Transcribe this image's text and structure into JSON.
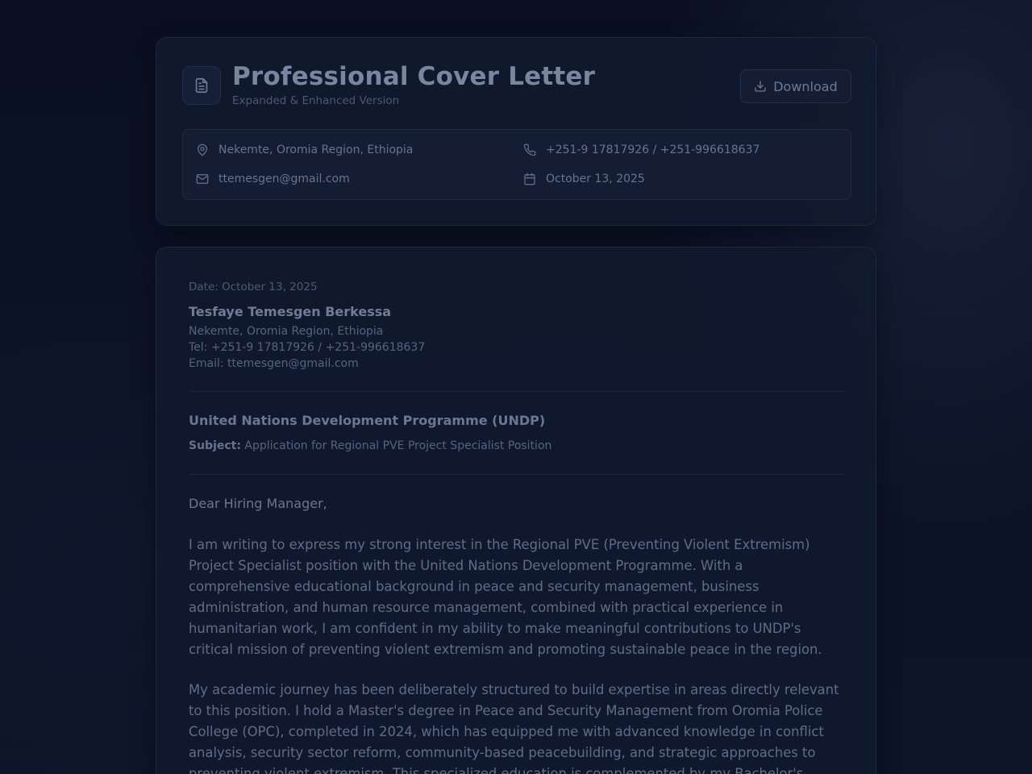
{
  "header": {
    "title": "Professional Cover Letter",
    "subtitle": "Expanded & Enhanced Version",
    "download_label": "Download",
    "icon": "document-icon"
  },
  "contact": {
    "location": "Nekemte, Oromia Region, Ethiopia",
    "phone": "+251-9 17817926 / +251-996618637",
    "email": "ttemesgen@gmail.com",
    "date": "October 13, 2025",
    "icons": [
      "map-pin-icon",
      "phone-icon",
      "mail-icon",
      "calendar-icon"
    ]
  },
  "letter": {
    "date_line": "Date: October 13, 2025",
    "sender_name": "Tesfaye Temesgen Berkessa",
    "sender_address": "Nekemte, Oromia Region, Ethiopia",
    "sender_tel": "Tel: +251-9 17817926 / +251-996618637",
    "sender_email": "Email: ttemesgen@gmail.com",
    "organization": "United Nations Development Programme (UNDP)",
    "subject_label": "Subject:",
    "subject_text": "Application for Regional PVE Project Specialist Position",
    "salutation": "Dear Hiring Manager,",
    "paragraphs": [
      "I am writing to express my strong interest in the Regional PVE (Preventing Violent Extremism) Project Specialist position with the United Nations Development Programme. With a comprehensive educational background in peace and security management, business administration, and human resource management, combined with practical experience in humanitarian work, I am confident in my ability to make meaningful contributions to UNDP's critical mission of preventing violent extremism and promoting sustainable peace in the region.",
      "My academic journey has been deliberately structured to build expertise in areas directly relevant to this position. I hold a Master's degree in Peace and Security Management from Oromia Police College (OPC), completed in 2024, which has equipped me with advanced knowledge in conflict analysis, security sector reform, community-based peacebuilding, and strategic approaches to preventing violent extremism. This specialized education is complemented by my Bachelor's degree in Business"
    ]
  },
  "colors": {
    "background": "#0b1124",
    "card": "#11192e",
    "text": "#6d7d98"
  }
}
